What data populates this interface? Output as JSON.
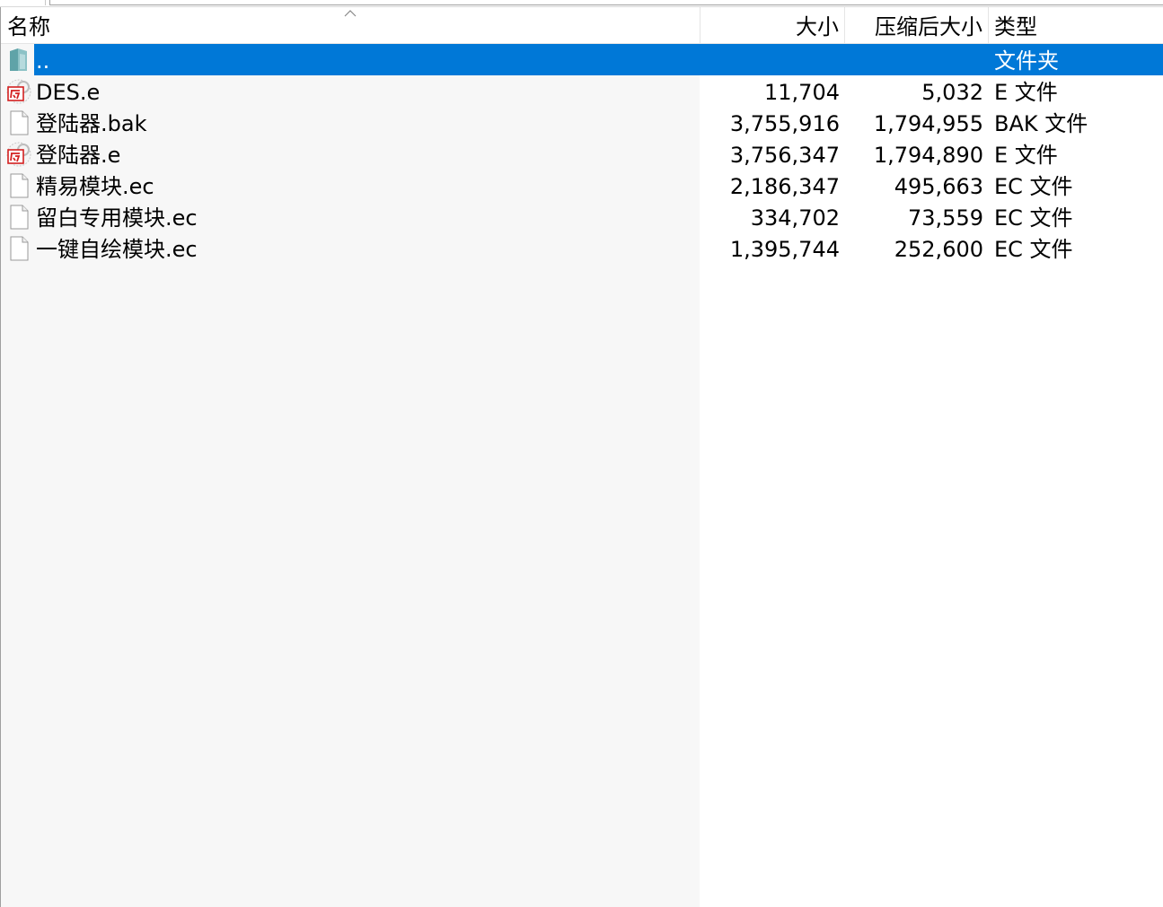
{
  "columns": {
    "name": "名称",
    "size": "大小",
    "compressed_size": "压缩后大小",
    "type": "类型"
  },
  "sort": {
    "column": "name",
    "direction": "ascending",
    "icon": "chevron-up-icon"
  },
  "colors": {
    "selection": "#0078d7",
    "name_column_shade": "#f7f7f7",
    "e_icon_red": "#d42020"
  },
  "files": [
    {
      "name": "..",
      "size": "",
      "compressed_size": "",
      "type": "文件夹",
      "icon": "folder-up-icon",
      "selected": true
    },
    {
      "name": "DES.e",
      "size": "11,704",
      "compressed_size": "5,032",
      "type": "E 文件",
      "icon": "e-language-file-icon",
      "selected": false
    },
    {
      "name": "登陆器.bak",
      "size": "3,755,916",
      "compressed_size": "1,794,955",
      "type": "BAK 文件",
      "icon": "blank-file-icon",
      "selected": false
    },
    {
      "name": "登陆器.e",
      "size": "3,756,347",
      "compressed_size": "1,794,890",
      "type": "E 文件",
      "icon": "e-language-file-icon",
      "selected": false
    },
    {
      "name": "精易模块.ec",
      "size": "2,186,347",
      "compressed_size": "495,663",
      "type": "EC 文件",
      "icon": "blank-file-icon",
      "selected": false
    },
    {
      "name": "留白专用模块.ec",
      "size": "334,702",
      "compressed_size": "73,559",
      "type": "EC 文件",
      "icon": "blank-file-icon",
      "selected": false
    },
    {
      "name": "一键自绘模块.ec",
      "size": "1,395,744",
      "compressed_size": "252,600",
      "type": "EC 文件",
      "icon": "blank-file-icon",
      "selected": false
    }
  ]
}
